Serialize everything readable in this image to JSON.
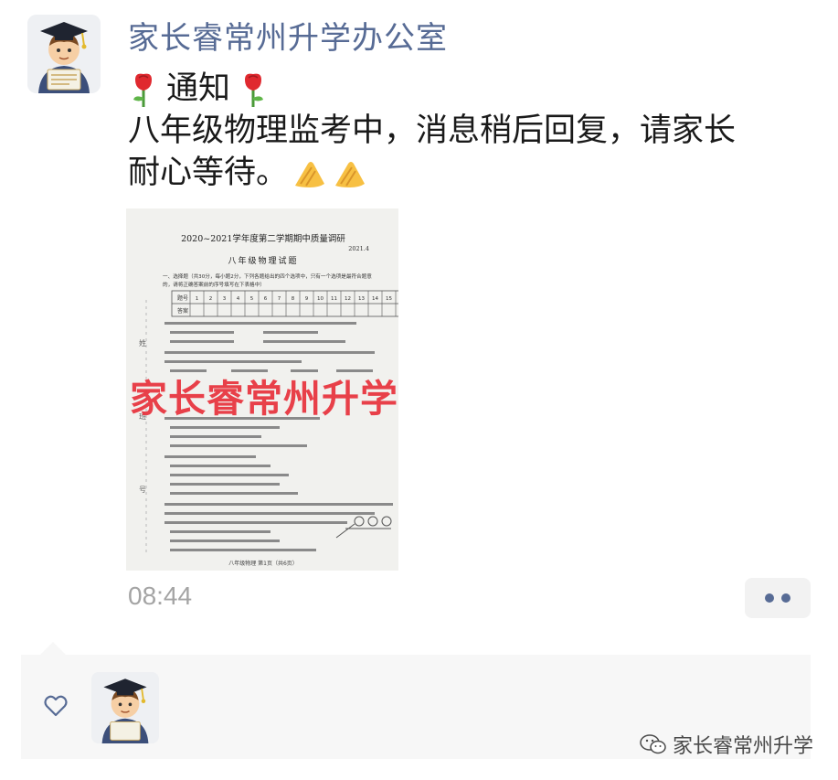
{
  "post": {
    "author": "家长睿常州升学办公室",
    "notice_title": "通知",
    "body_line1": "八年级物理监考中，消息稍后回复，请家长",
    "body_line2": "耐心等待。",
    "timestamp": "08:44"
  },
  "photo": {
    "exam_title": "2020~2021学年度第二学期期中质量调研",
    "exam_date": "2021.4",
    "exam_subtitle": "八年级物理试题",
    "section_intro": "一、选择题（共30分，每小题2分，下列各题给出的四个选项中，只有一个选项是最符合题意",
    "section_intro2": "的，请将正确答案前的序号填写在下表格中）",
    "table_row1_label": "题号",
    "table_row2_label": "答案",
    "table_numbers": [
      "1",
      "2",
      "3",
      "4",
      "5",
      "6",
      "7",
      "8",
      "9",
      "10",
      "11",
      "12",
      "13",
      "14",
      "15"
    ],
    "footer": "八年级物理  第1页（共6页）",
    "watermark": "家长睿常州升学"
  },
  "footer": {
    "brand": "家长睿常州升学"
  },
  "icons": {
    "rose": "rose-emoji",
    "clap": "clapping-hands-emoji",
    "heart": "heart-outline-icon",
    "more": "more-dots-icon",
    "wechat": "wechat-logo-icon"
  },
  "colors": {
    "author": "#576b95",
    "watermark": "#e8323c",
    "timestamp": "#a4a4a4"
  }
}
